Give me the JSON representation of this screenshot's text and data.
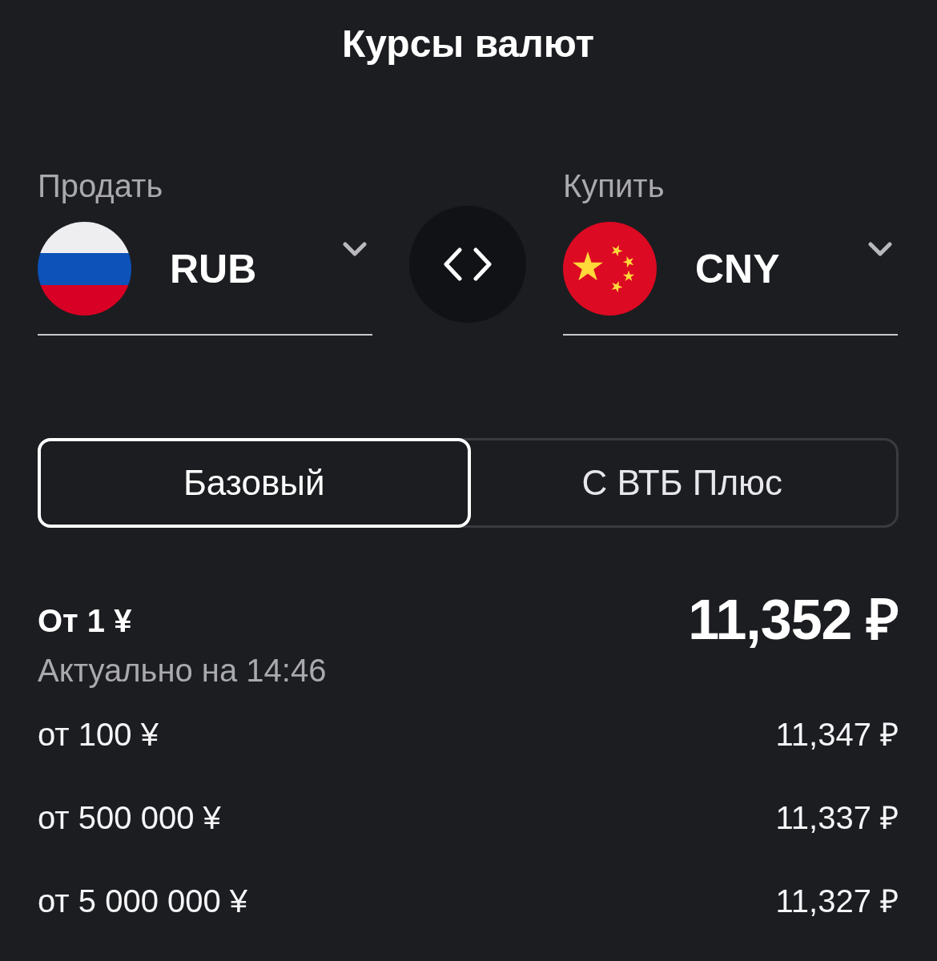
{
  "title": "Курсы валют",
  "exchange": {
    "sides": [
      {
        "label": "Продать",
        "currency": "RUB"
      },
      {
        "label": "Купить",
        "currency": "CNY"
      }
    ]
  },
  "tabs": [
    {
      "label": "Базовый",
      "selected": true
    },
    {
      "label": "С ВТБ Плюс",
      "selected": false
    }
  ],
  "rates": {
    "main": {
      "label": "От 1 ¥",
      "rate": "11,352 ₽",
      "updated": "Актуально на 14:46"
    },
    "tiers": [
      {
        "label": "от 100 ¥",
        "rate": "11,347 ₽"
      },
      {
        "label": "от 500 000 ¥",
        "rate": "11,337 ₽"
      },
      {
        "label": "от 5 000 000 ¥",
        "rate": "11,327 ₽"
      }
    ]
  }
}
